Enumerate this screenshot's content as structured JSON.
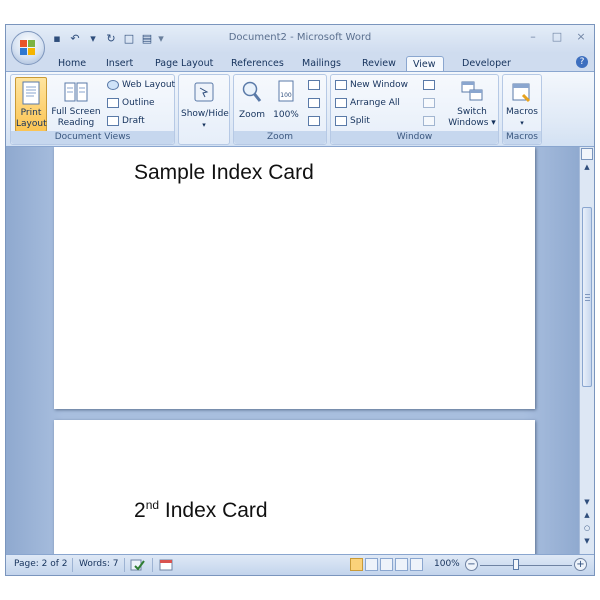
{
  "title": "Document2 - Microsoft Word",
  "window_controls": {
    "minimize": "–",
    "maximize": "□",
    "close": "×"
  },
  "qat": {
    "save": "▪",
    "undo": "↶",
    "redo": "↻",
    "new": "□",
    "open": "▤",
    "more": "▾"
  },
  "tabs": [
    {
      "label": "Home",
      "active": false
    },
    {
      "label": "Insert",
      "active": false
    },
    {
      "label": "Page Layout",
      "active": false
    },
    {
      "label": "References",
      "active": false
    },
    {
      "label": "Mailings",
      "active": false
    },
    {
      "label": "Review",
      "active": false
    },
    {
      "label": "View",
      "active": true
    },
    {
      "label": "Developer",
      "active": false
    }
  ],
  "help_label": "?",
  "ribbon": {
    "document_views": {
      "label": "Document Views",
      "print_layout": [
        "Print",
        "Layout"
      ],
      "full_screen": [
        "Full Screen",
        "Reading"
      ],
      "web_layout": "Web Layout",
      "outline": "Outline",
      "draft": "Draft"
    },
    "show_hide": {
      "label": "Show/Hide",
      "arrow": "▾"
    },
    "zoom": {
      "label": "Zoom",
      "zoom": "Zoom",
      "hundred": "100%"
    },
    "window": {
      "label": "Window",
      "new_window": "New Window",
      "arrange_all": "Arrange All",
      "split": "Split",
      "switch": [
        "Switch",
        "Windows ▾"
      ]
    },
    "macros": {
      "label": "Macros",
      "macros": "Macros",
      "arrow": "▾"
    }
  },
  "document": {
    "card1": "Sample Index Card",
    "card2_num": "2",
    "card2_sup": "nd",
    "card2_rest": " Index Card"
  },
  "scroll": {
    "up": "▲",
    "down": "▼",
    "prev": "⯭",
    "select": "○",
    "next": "⯯"
  },
  "status": {
    "page": "Page: 2 of 2",
    "words": "Words: 7",
    "zoom": "100%",
    "zoom_out": "−",
    "zoom_in": "+"
  },
  "colors": {
    "accent": "#fbc453",
    "ribbon": "#dfe9f6",
    "frame": "#c9daf0"
  }
}
